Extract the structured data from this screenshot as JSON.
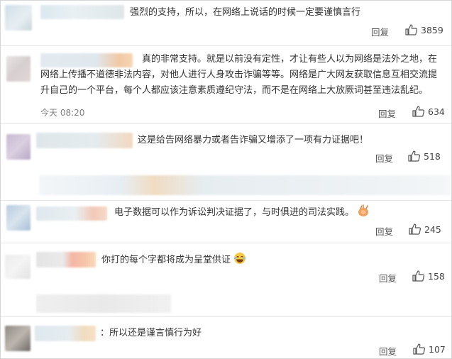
{
  "comments": [
    {
      "text": "强烈的支持，所以，在网络上说话的时候一定要谨慎言行",
      "reply": "回复",
      "likes": "3859"
    },
    {
      "text_lines": [
        "真的非常支持。就是以前没有定性，才让有些人以为网络是法外之地，在",
        "网络上传播不道德非法内容，对他人进行人身攻击诈骗等等。网络是广大网友获取信息互相交流提",
        "升自己的一个平台，每个人都应该注意素质遵纪守法，而不是在网络上大放厥词甚至违法乱纪。"
      ],
      "time": "今天 08:20",
      "reply": "回复",
      "likes": "634"
    },
    {
      "text": "这是给告网络暴力或者告诈骗又增添了一项有力证据吧！",
      "reply": "回复",
      "likes": "518"
    },
    {
      "text": "电子数据可以作为诉讼判决证据了，与时俱进的司法实践。",
      "reply": "回复",
      "likes": "245",
      "emoji": "clapping-hands"
    },
    {
      "text": "你打的每个字都将成为呈堂供证",
      "reply": "回复",
      "likes": "158",
      "emoji": "laughing-face"
    },
    {
      "text": "：所以还是谨言慎行为好",
      "reply": "回复",
      "likes": "107"
    }
  ],
  "colors": {
    "text": "#333333",
    "meta": "#808080",
    "separator": "#e6e6e6"
  },
  "icons": {
    "like": "thumbs-up-icon"
  }
}
